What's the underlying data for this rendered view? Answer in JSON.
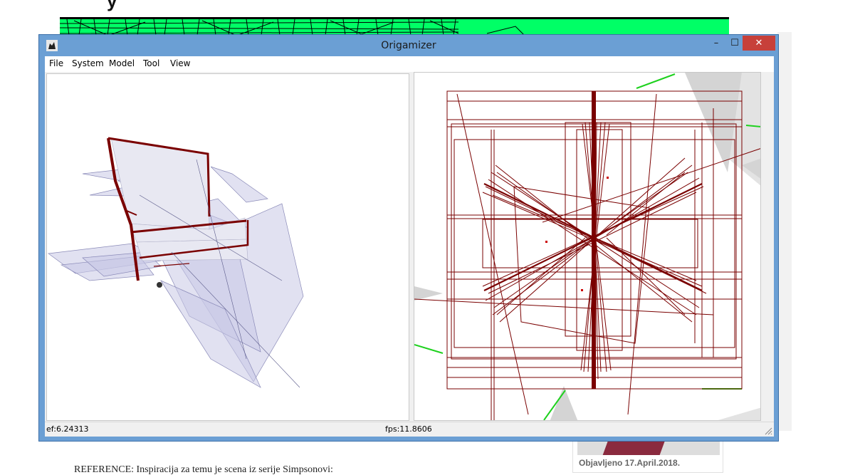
{
  "window": {
    "title": "Origamizer",
    "minimize_glyph": "–",
    "maximize_glyph": "☐",
    "close_glyph": "✕",
    "app_icon": "origamizer-app-icon"
  },
  "menu": {
    "items": [
      "File",
      "System",
      "Model",
      "Tool",
      "View"
    ]
  },
  "status": {
    "ef": "ef:6.24313",
    "fps": "fps:11.8606"
  },
  "background_page": {
    "sidebar_date": "Objavljeno 17.April.2018.",
    "reference_text": "REFERENCE: Inspiracija za temu je scena iz serije Simpsonovi:"
  },
  "colors": {
    "titlebar": "#6b9fd4",
    "close_button": "#c7403a",
    "crease_red": "#7a0000",
    "banner_green": "#00ff66",
    "face_fill": "#c9c9e6"
  }
}
